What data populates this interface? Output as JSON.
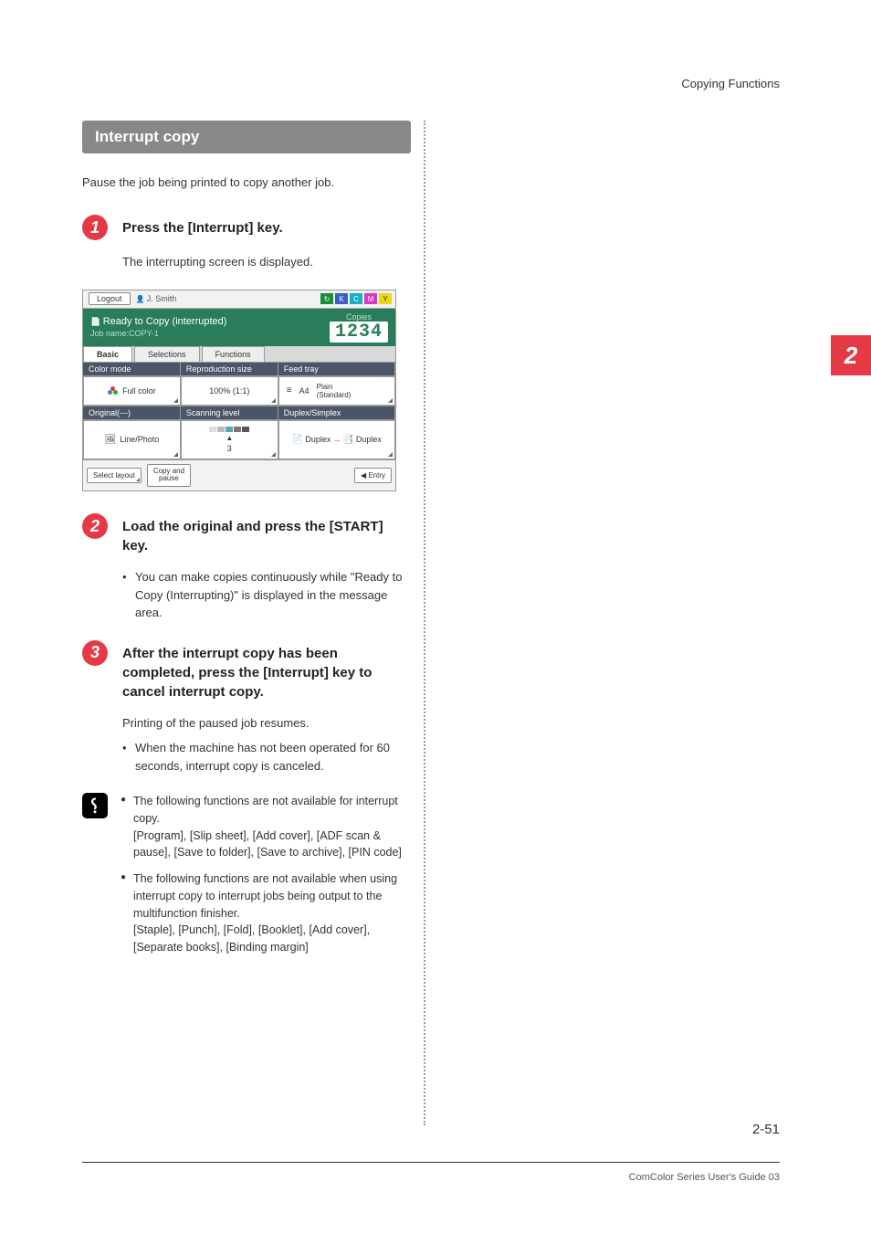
{
  "header": {
    "chapter": "Copying Functions"
  },
  "side_tab": {
    "num": "2"
  },
  "section": {
    "title": "Interrupt copy",
    "intro": "Pause the job being printed to copy another job."
  },
  "steps": [
    {
      "num": "1",
      "title": "Press the [Interrupt] key.",
      "desc": "The interrupting screen is displayed."
    },
    {
      "num": "2",
      "title": "Load the original and press the [START] key.",
      "bullets": [
        "You can make copies continuously while \"Ready to Copy (Interrupting)\" is displayed in the message area."
      ]
    },
    {
      "num": "3",
      "title": "After the interrupt copy has been completed, press the [Interrupt] key to cancel interrupt copy.",
      "desc": "Printing of the paused job resumes.",
      "bullets": [
        "When the machine has not been operated for 60 seconds, interrupt copy is canceled."
      ]
    }
  ],
  "notes": [
    "The following functions are not available for interrupt copy.\n[Program], [Slip sheet], [Add cover], [ADF scan & pause], [Save to folder], [Save to archive], [PIN code]",
    "The following functions are not available when using interrupt copy to interrupt jobs being output to the multifunction finisher.\n[Staple], [Punch], [Fold], [Booklet], [Add cover], [Separate books], [Binding margin]"
  ],
  "screen": {
    "logout": "Logout",
    "user": "J. Smith",
    "ready": "Ready to Copy (interrupted)",
    "jobname": "Job name:COPY-1",
    "copies_label": "Copies",
    "copies_value": "1234",
    "tabs": [
      "Basic",
      "Selections",
      "Functions"
    ],
    "row1_heads": [
      "Color mode",
      "Reproduction size",
      "Feed tray"
    ],
    "row1_vals": {
      "color": "Full color",
      "repro": "100% (1:1)",
      "tray_size": "A4",
      "tray_type": "Plain\n(Standard)"
    },
    "row2_heads": [
      "Original(---)",
      "Scanning level",
      "Duplex/Simplex"
    ],
    "row2_vals": {
      "original": "Line/Photo",
      "scan_level": "3",
      "duplex_a": "Duplex",
      "duplex_b": "Duplex"
    },
    "bottom": {
      "select_layout": "Select layout",
      "copy_pause": "Copy and\npause",
      "entry": "◀ Entry"
    }
  },
  "footer": {
    "page": "2-51",
    "guide": "ComColor Series User's Guide 03"
  }
}
